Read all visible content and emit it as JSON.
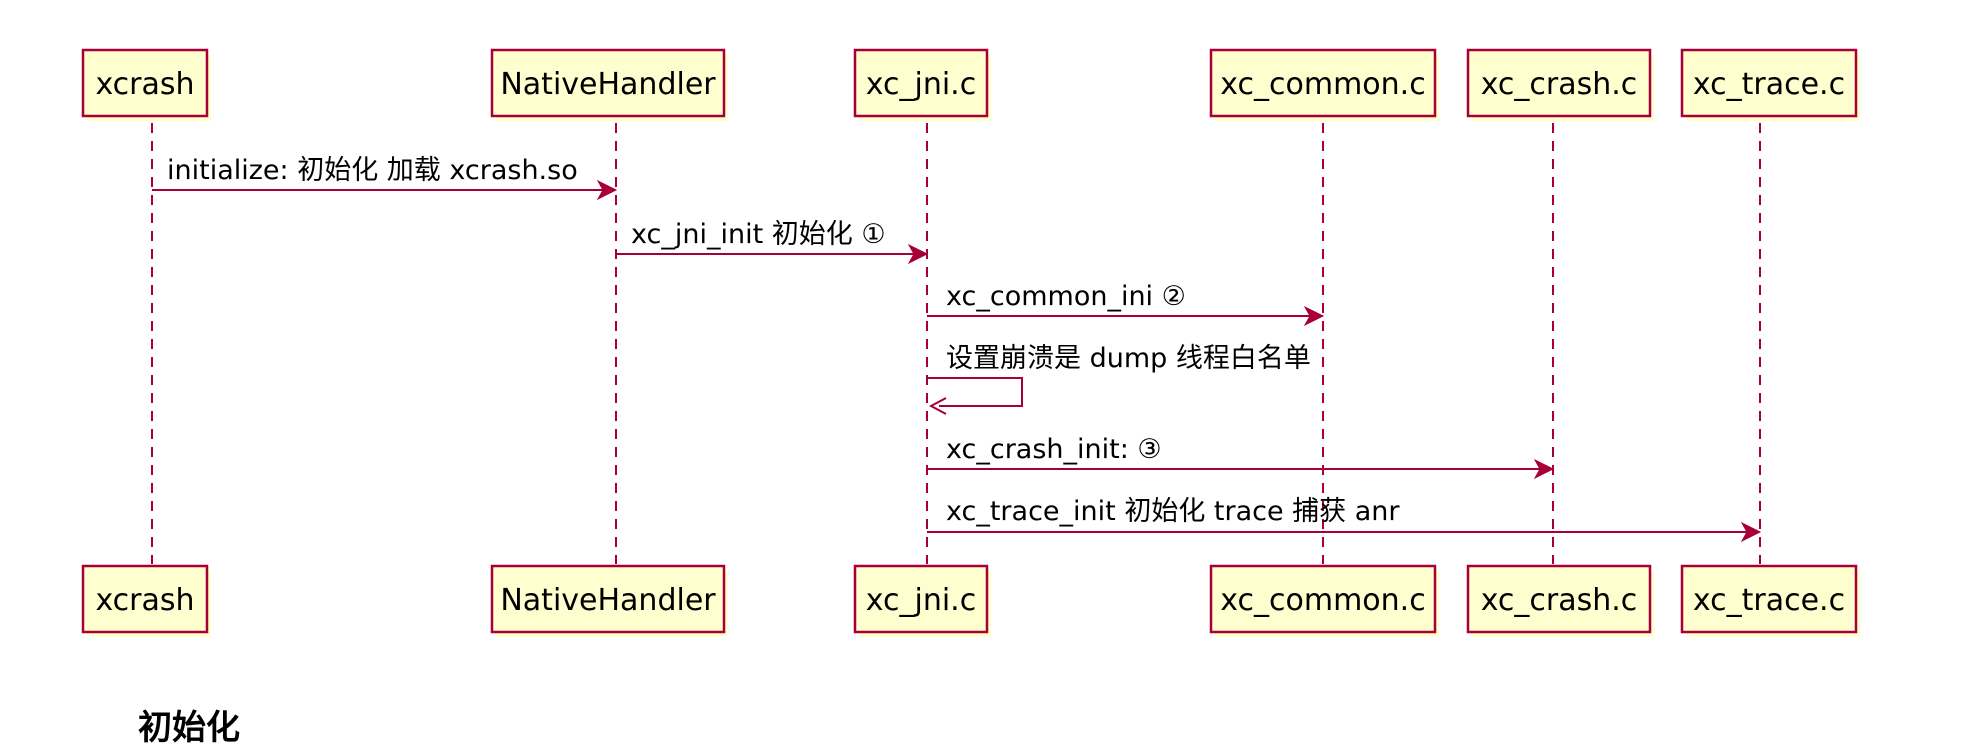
{
  "participants": [
    {
      "id": "xcrash",
      "label": "xcrash"
    },
    {
      "id": "native_handler",
      "label": "NativeHandler"
    },
    {
      "id": "xc_jni",
      "label": "xc_jni.c"
    },
    {
      "id": "xc_common",
      "label": "xc_common.c"
    },
    {
      "id": "xc_crash",
      "label": "xc_crash.c"
    },
    {
      "id": "xc_trace",
      "label": "xc_trace.c"
    }
  ],
  "messages": [
    {
      "from": "xcrash",
      "to": "native_handler",
      "label": "initialize: 初始化 加载 xcrash.so"
    },
    {
      "from": "native_handler",
      "to": "xc_jni",
      "label": "xc_jni_init 初始化 ①"
    },
    {
      "from": "xc_jni",
      "to": "xc_common",
      "label": "xc_common_ini ②"
    },
    {
      "from": "xc_jni",
      "to": "xc_jni",
      "label": "设置崩溃是 dump 线程白名单"
    },
    {
      "from": "xc_jni",
      "to": "xc_crash",
      "label": "xc_crash_init: ③"
    },
    {
      "from": "xc_jni",
      "to": "xc_trace",
      "label": "xc_trace_init 初始化 trace 捕获 anr"
    }
  ],
  "colors": {
    "box_fill": "#FEFECE",
    "box_border": "#A80036",
    "arrow": "#A80036"
  },
  "caption": "初始化"
}
